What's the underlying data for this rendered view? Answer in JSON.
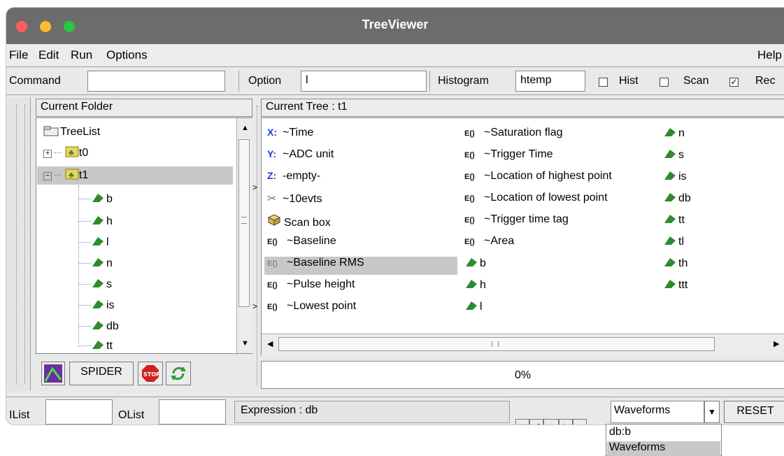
{
  "window": {
    "title": "TreeViewer"
  },
  "menu": {
    "file": "File",
    "edit": "Edit",
    "run": "Run",
    "options": "Options",
    "help": "Help"
  },
  "toolbar": {
    "command_label": "Command",
    "command_value": "",
    "option_label": "Option",
    "option_value": "l",
    "histogram_label": "Histogram",
    "histogram_value": "htemp",
    "hist_label": "Hist",
    "scan_label": "Scan",
    "rec_label": "Rec",
    "hist_checked": false,
    "scan_checked": false,
    "rec_checked": true
  },
  "left": {
    "header": "Current Folder",
    "root": "TreeList",
    "trees": [
      "t0",
      "t1"
    ],
    "leaves": [
      "b",
      "h",
      "l",
      "n",
      "s",
      "is",
      "db",
      "tt"
    ],
    "spider_label": "SPIDER"
  },
  "right": {
    "header": "Current Tree : t1",
    "col1": [
      {
        "icon": "x-axis-icon",
        "prefix": "X:",
        "label": "~Time"
      },
      {
        "icon": "y-axis-icon",
        "prefix": "Y:",
        "label": "~ADC unit"
      },
      {
        "icon": "z-axis-icon",
        "prefix": "Z:",
        "label": "-empty-"
      },
      {
        "icon": "scissors-icon",
        "prefix": "",
        "label": "~10evts"
      },
      {
        "icon": "scan-box-icon",
        "prefix": "",
        "label": "Scan box"
      },
      {
        "icon": "expression-icon",
        "prefix": "E()",
        "label": "~Baseline"
      },
      {
        "icon": "expression-icon",
        "prefix": "E()",
        "label": "~Baseline RMS"
      },
      {
        "icon": "expression-icon",
        "prefix": "E()",
        "label": "~Pulse height"
      },
      {
        "icon": "expression-icon",
        "prefix": "E()",
        "label": "~Lowest point"
      }
    ],
    "col2": [
      {
        "icon": "expression-icon",
        "prefix": "E()",
        "label": "~Saturation flag"
      },
      {
        "icon": "expression-icon",
        "prefix": "E()",
        "label": "~Trigger Time"
      },
      {
        "icon": "expression-icon",
        "prefix": "E()",
        "label": "~Location of highest point"
      },
      {
        "icon": "expression-icon",
        "prefix": "E()",
        "label": "~Location of lowest point"
      },
      {
        "icon": "expression-icon",
        "prefix": "E()",
        "label": "~Trigger time tag"
      },
      {
        "icon": "expression-icon",
        "prefix": "E()",
        "label": "~Area"
      },
      {
        "icon": "leaf-icon",
        "prefix": "",
        "label": "b"
      },
      {
        "icon": "leaf-icon",
        "prefix": "",
        "label": "h"
      },
      {
        "icon": "leaf-icon",
        "prefix": "",
        "label": "l"
      }
    ],
    "col3": [
      "n",
      "s",
      "is",
      "db",
      "tt",
      "tl",
      "th",
      "ttt"
    ],
    "progress": "0%"
  },
  "status": {
    "ilist_label": "IList",
    "olist_label": "OList",
    "expression": "Expression : db",
    "combo_value": "Waveforms",
    "reset_label": "RESET",
    "dropdown_options": [
      "db:b",
      "Waveforms"
    ]
  },
  "colors": {
    "titlebar": "#6c6c6c",
    "selection": "#c8c8c8",
    "leaf_green": "#2e8b2e",
    "axis_blue": "#1a3fd8"
  }
}
